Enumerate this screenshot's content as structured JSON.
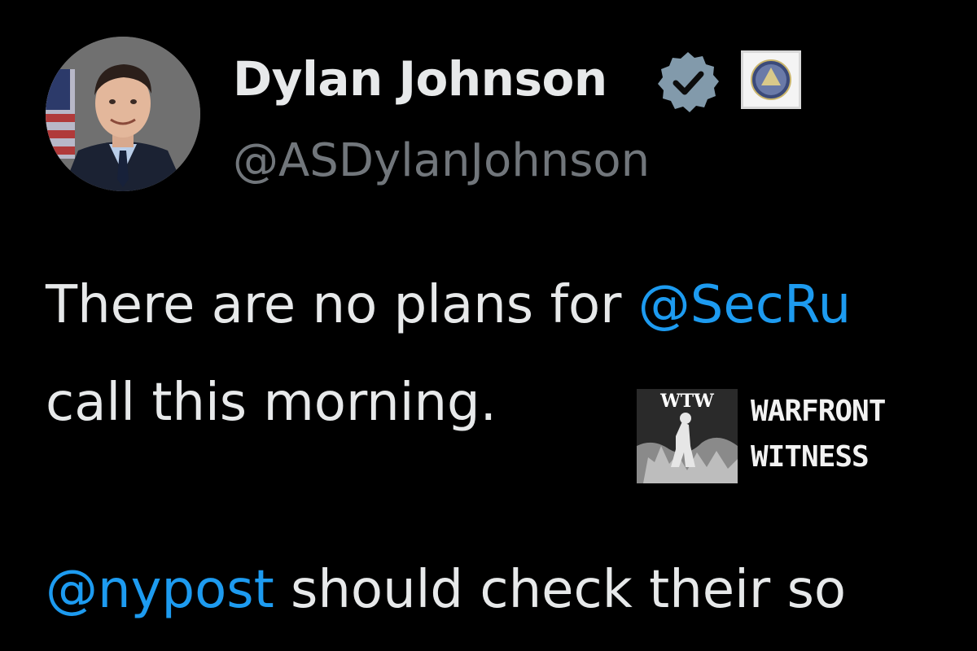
{
  "author": {
    "display_name": "Dylan Johnson",
    "handle": "@ASDylanJohnson",
    "verified_badge_color": "#829aab"
  },
  "tweet": {
    "line1_text": "There are no plans for ",
    "line1_mention": "@SecRu",
    "line2_text": "call this morning.",
    "line3_mention": "@nypost",
    "line3_text": " should check their so"
  },
  "watermark": {
    "logo_letters": "WTW",
    "line1": "WARFRONT",
    "line2": "WITNESS"
  },
  "colors": {
    "background": "#000000",
    "text": "#e7e9ea",
    "muted": "#71767b",
    "link": "#1d9bf0"
  },
  "icons": {
    "verified": "verified-badge-icon",
    "affiliate": "government-seal-icon"
  }
}
